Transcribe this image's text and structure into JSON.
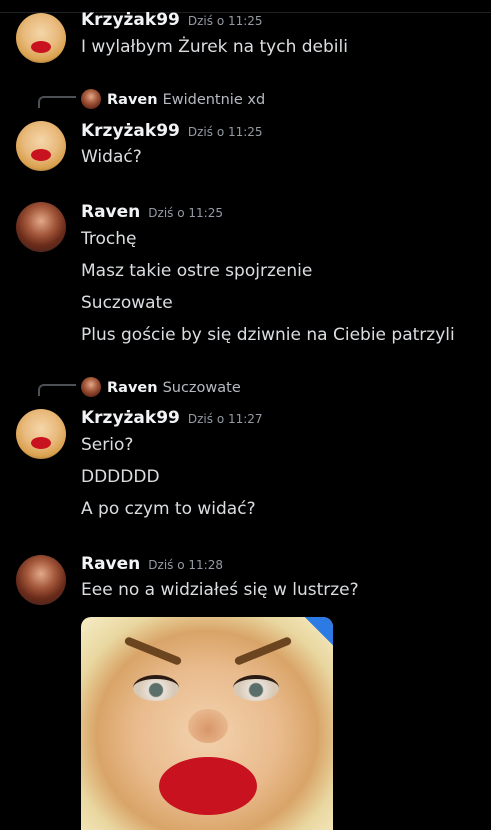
{
  "messages": [
    {
      "username": "Krzyżak99",
      "timestamp": "Dziś o 11:25",
      "lines": [
        "I wylałbym Żurek na tych debili"
      ]
    },
    {
      "reply": {
        "username": "Raven",
        "text": "Ewidentnie xd"
      },
      "username": "Krzyżak99",
      "timestamp": "Dziś o 11:25",
      "lines": [
        "Widać?"
      ]
    },
    {
      "username": "Raven",
      "timestamp": "Dziś o 11:25",
      "lines": [
        "Trochę",
        "Masz takie ostre spojrzenie",
        "Suczowate",
        "Plus goście by się dziwnie na Ciebie patrzyli"
      ]
    },
    {
      "reply": {
        "username": "Raven",
        "text": "Suczowate"
      },
      "username": "Krzyżak99",
      "timestamp": "Dziś o 11:27",
      "lines": [
        "Serio?",
        "DDDDDD",
        "A po czym to widać?"
      ]
    },
    {
      "username": "Raven",
      "timestamp": "Dziś o 11:28",
      "lines": [
        "Eee no a widziałeś się w lustrze?"
      ],
      "attachment_icon": "image-attachment"
    }
  ],
  "colors": {
    "background": "#000000",
    "username": "#f2f3f5",
    "message_text": "#dbdee1",
    "timestamp": "#949ba4",
    "reply_spine": "#4e5058"
  }
}
